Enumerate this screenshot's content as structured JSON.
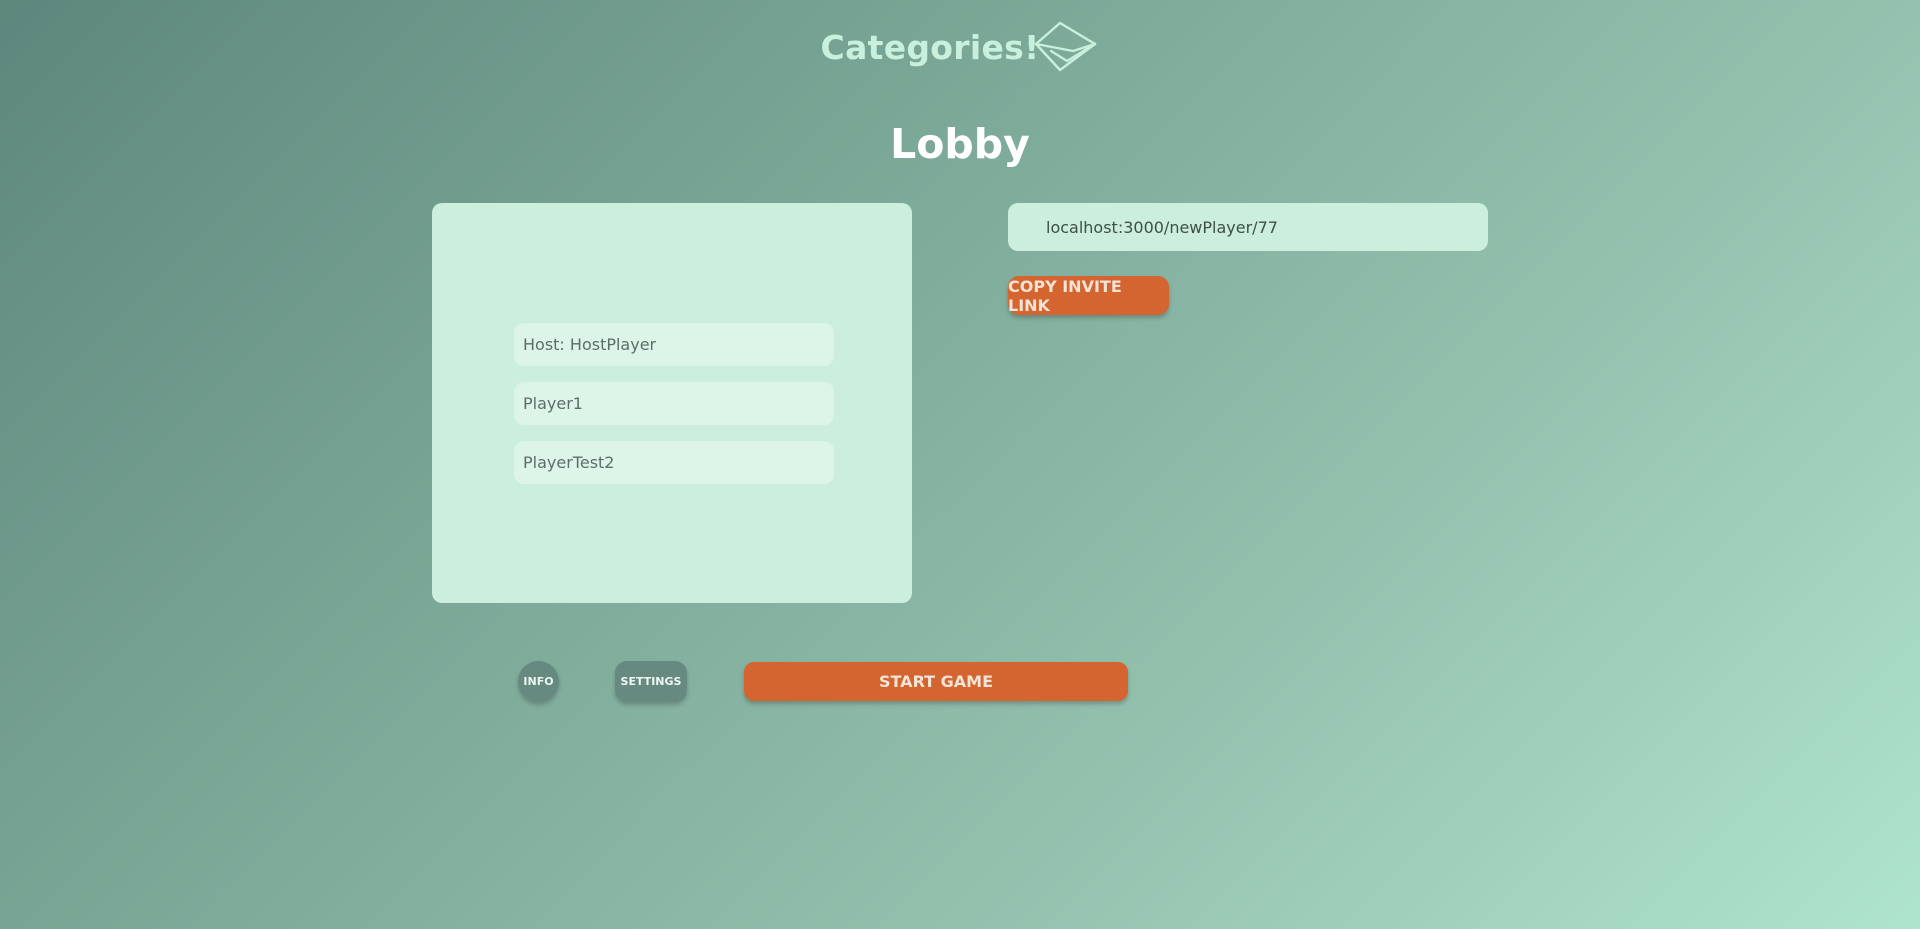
{
  "header": {
    "logo_text": "Categories!",
    "logo_icon": "paper-plane-envelope-icon"
  },
  "page": {
    "title": "Lobby"
  },
  "players": [
    "Host: HostPlayer",
    "Player1",
    "PlayerTest2"
  ],
  "invite": {
    "link": "localhost:3000/newPlayer/77",
    "copy_label": "COPY INVITE LINK"
  },
  "actions": {
    "info_label": "INFO",
    "settings_label": "SETTINGS",
    "start_label": "START GAME"
  },
  "colors": {
    "accent": "#d46530",
    "panel": "#cbeedd",
    "secondary_button": "#668a80"
  }
}
